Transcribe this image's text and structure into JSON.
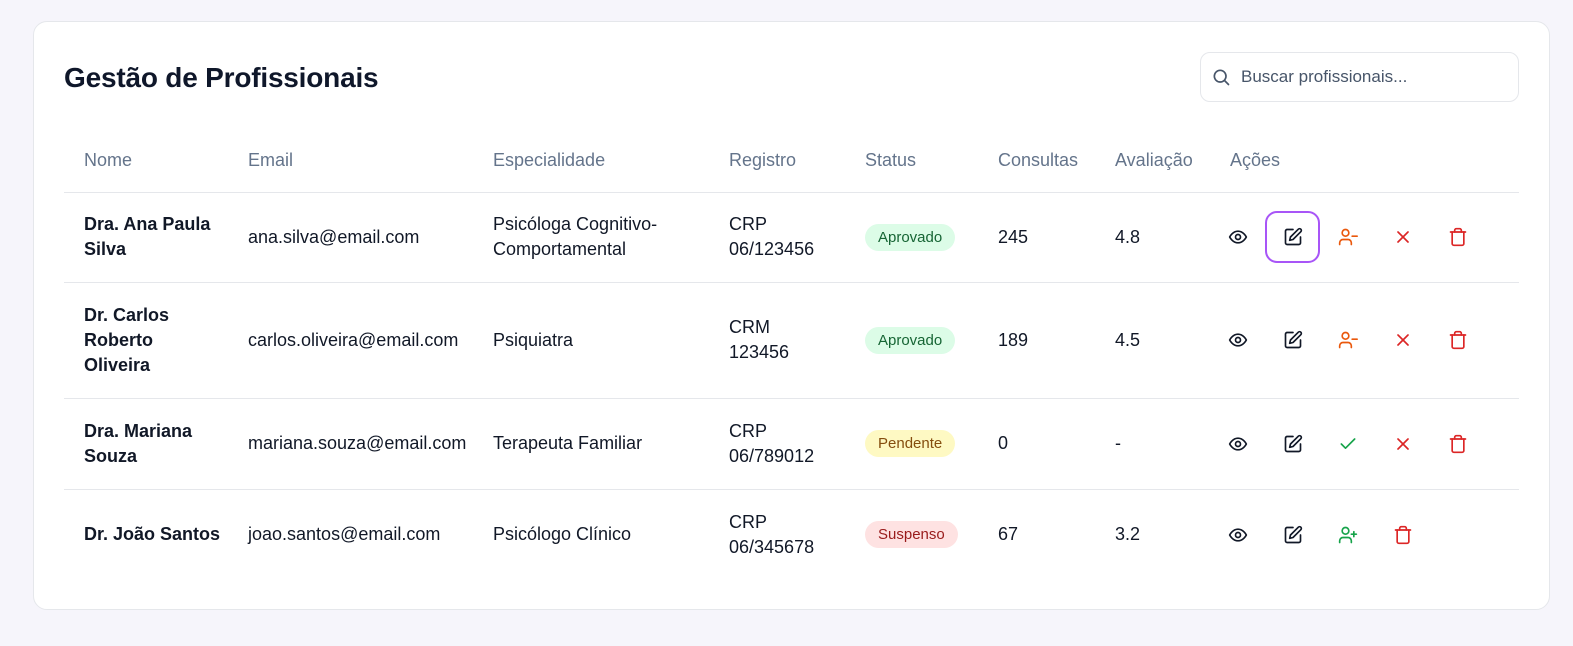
{
  "page": {
    "title": "Gestão de Profissionais",
    "search_placeholder": "Buscar profissionais..."
  },
  "colors": {
    "approve_badge_bg": "#dcfce7",
    "pending_badge_bg": "#fef9c3",
    "suspended_badge_bg": "#fee2e2",
    "focus_ring": "#a855f7",
    "suspend_icon": "#ea580c",
    "approve_icon": "#16a34a",
    "danger_icon": "#dc2626"
  },
  "table": {
    "headers": [
      "Nome",
      "Email",
      "Especialidade",
      "Registro",
      "Status",
      "Consultas",
      "Avaliação",
      "Ações"
    ],
    "rows": [
      {
        "name": "Dra. Ana Paula Silva",
        "email": "ana.silva@email.com",
        "specialty": "Psicóloga Cognitivo-Comportamental",
        "registry": "CRP 06/123456",
        "status": "Aprovado",
        "consultations": "245",
        "rating": "4.8",
        "actions": [
          "eye-icon",
          "edit-icon",
          "user-minus-icon",
          "x-icon",
          "trash-icon"
        ]
      },
      {
        "name": "Dr. Carlos Roberto Oliveira",
        "email": "carlos.oliveira@email.com",
        "specialty": "Psiquiatra",
        "registry": "CRM 123456",
        "status": "Aprovado",
        "consultations": "189",
        "rating": "4.5",
        "actions": [
          "eye-icon",
          "edit-icon",
          "user-minus-icon",
          "x-icon",
          "trash-icon"
        ]
      },
      {
        "name": "Dra. Mariana Souza",
        "email": "mariana.souza@email.com",
        "specialty": "Terapeuta Familiar",
        "registry": "CRP 06/789012",
        "status": "Pendente",
        "consultations": "0",
        "rating": "-",
        "actions": [
          "eye-icon",
          "edit-icon",
          "check-icon",
          "x-icon",
          "trash-icon"
        ]
      },
      {
        "name": "Dr. João Santos",
        "email": "joao.santos@email.com",
        "specialty": "Psicólogo Clínico",
        "registry": "CRP 06/345678",
        "status": "Suspenso",
        "consultations": "67",
        "rating": "3.2",
        "actions": [
          "eye-icon",
          "edit-icon",
          "user-plus-icon",
          "trash-icon"
        ]
      }
    ]
  }
}
